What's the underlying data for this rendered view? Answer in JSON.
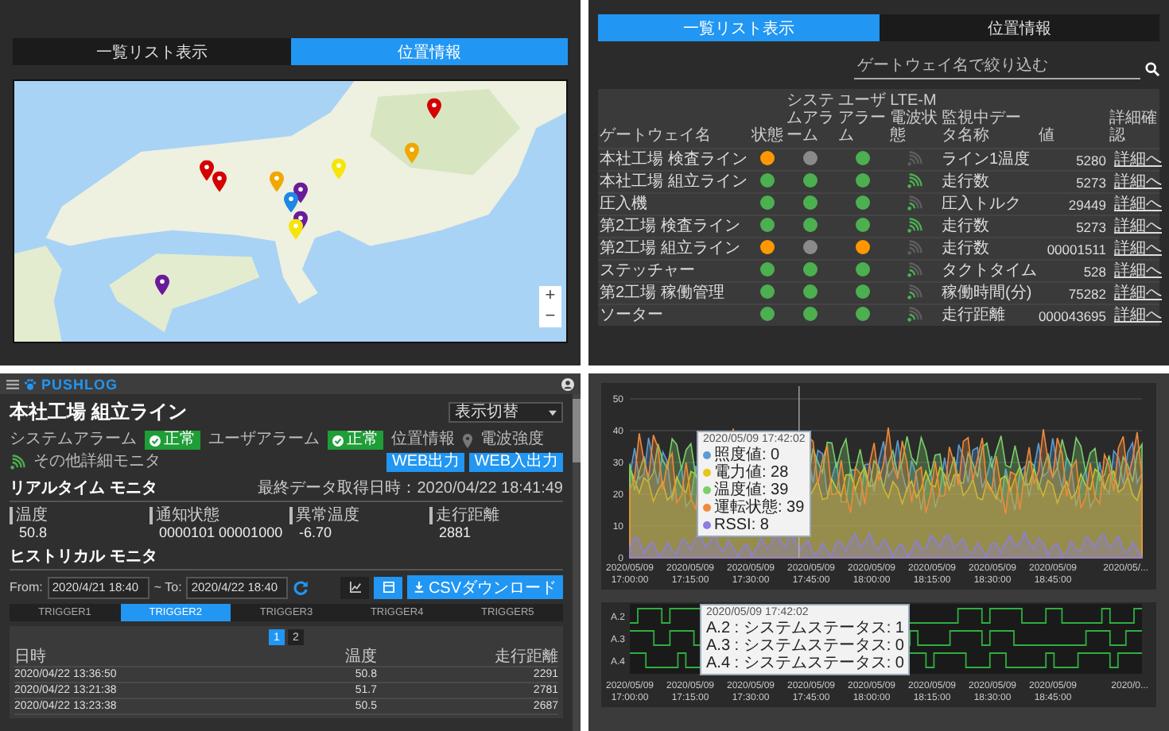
{
  "map_panel": {
    "tabs": [
      {
        "label": "一覧リスト表示",
        "selected": false
      },
      {
        "label": "位置情報",
        "selected": true
      }
    ],
    "pins": [
      {
        "color": "#d50000"
      },
      {
        "color": "#f0a800"
      },
      {
        "color": "#f5e50a"
      },
      {
        "color": "#d50000"
      },
      {
        "color": "#d50000"
      },
      {
        "color": "#f0a800"
      },
      {
        "color": "#6a1b9a"
      },
      {
        "color": "#1e88e5"
      },
      {
        "color": "#6a1b9a"
      },
      {
        "color": "#f5e50a"
      },
      {
        "color": "#6a1b9a"
      }
    ],
    "zoom_in": "+",
    "zoom_out": "−"
  },
  "list_panel": {
    "tabs": [
      {
        "label": "一覧リスト表示",
        "selected": true
      },
      {
        "label": "位置情報",
        "selected": false
      }
    ],
    "search": {
      "placeholder": "ゲートウェイ名で絞り込む"
    },
    "table": {
      "columns": [
        "ゲートウェイ名",
        "状態",
        "システムアラーム",
        "ユーザアラーム",
        "LTE-M電波状態",
        "監視中データ名称",
        "値",
        "詳細確認"
      ],
      "rows": [
        {
          "name": "本社工場 検査ライン",
          "indicators": [
            {
              "color": "#ff9800"
            },
            {
              "color": "#8a8a8a"
            },
            {
              "color": "#4caf50"
            }
          ],
          "signal": {
            "kind": "none"
          },
          "data_name": "ライン1温度",
          "value": "5280",
          "link": "詳細へ"
        },
        {
          "name": "本社工場 組立ライン",
          "indicators": [
            {
              "color": "#4caf50"
            },
            {
              "color": "#4caf50"
            },
            {
              "color": "#4caf50"
            }
          ],
          "signal": {
            "kind": "strong"
          },
          "data_name": "走行数",
          "value": "5273",
          "link": "詳細へ"
        },
        {
          "name": "圧入機",
          "indicators": [
            {
              "color": "#4caf50"
            },
            {
              "color": "#4caf50"
            },
            {
              "color": "#4caf50"
            }
          ],
          "signal": {
            "kind": "weak"
          },
          "data_name": "圧入トルク",
          "value": "29449",
          "link": "詳細へ"
        },
        {
          "name": "第2工場 検査ライン",
          "indicators": [
            {
              "color": "#4caf50"
            },
            {
              "color": "#4caf50"
            },
            {
              "color": "#4caf50"
            }
          ],
          "signal": {
            "kind": "strong"
          },
          "data_name": "走行数",
          "value": "5273",
          "link": "詳細へ"
        },
        {
          "name": "第2工場 組立ライン",
          "indicators": [
            {
              "color": "#ff9800"
            },
            {
              "color": "#8a8a8a"
            },
            {
              "color": "#ff9800"
            }
          ],
          "signal": {
            "kind": "none"
          },
          "data_name": "走行数",
          "value": "00001511",
          "link": "詳細へ"
        },
        {
          "name": "ステッチャー",
          "indicators": [
            {
              "color": "#4caf50"
            },
            {
              "color": "#4caf50"
            },
            {
              "color": "#4caf50"
            }
          ],
          "signal": {
            "kind": "weak"
          },
          "data_name": "タクトタイム",
          "value": "528",
          "link": "詳細へ"
        },
        {
          "name": "第2工場 稼働管理",
          "indicators": [
            {
              "color": "#4caf50"
            },
            {
              "color": "#4caf50"
            },
            {
              "color": "#4caf50"
            }
          ],
          "signal": {
            "kind": "weak"
          },
          "data_name": "稼働時間(分)",
          "value": "75282",
          "link": "詳細へ"
        },
        {
          "name": "ソーター",
          "indicators": [
            {
              "color": "#4caf50"
            },
            {
              "color": "#4caf50"
            },
            {
              "color": "#4caf50"
            }
          ],
          "signal": {
            "kind": "weak"
          },
          "data_name": "走行距離",
          "value": "000043695",
          "link": "詳細へ"
        }
      ]
    }
  },
  "detail_panel": {
    "logo": "PUSHLOG",
    "title": "本社工場 組立ライン",
    "view_select": "表示切替",
    "status": [
      {
        "kind": "badge",
        "label": "システムアラーム",
        "badge": "正常"
      },
      {
        "kind": "badge",
        "label": "ユーザアラーム",
        "badge": "正常"
      },
      {
        "kind": "pin",
        "label": "位置情報"
      },
      {
        "kind": "signal",
        "label": "電波強度"
      },
      {
        "kind": "text",
        "label": "その他詳細モニタ"
      }
    ],
    "buttons": [
      "WEB出力",
      "WEB入出力"
    ],
    "realtime": {
      "title": "リアルタイム モニタ",
      "updated": "最終データ取得日時：2020/04/22 18:41:49",
      "cells": [
        {
          "label": "温度",
          "value": "50.8"
        },
        {
          "label": "通知状態",
          "value": "0000101 00001000"
        },
        {
          "label": "異常温度",
          "value": "-6.70"
        },
        {
          "label": "走行距離",
          "value": "2881"
        }
      ]
    },
    "historical": {
      "title": "ヒストリカル モニタ",
      "from_label": "From:",
      "from": "2020/4/21 18:40",
      "to_label": "~ To:",
      "to": "2020/4/22 18:40",
      "view_buttons": [
        {
          "kind": "chart",
          "selected": false
        },
        {
          "kind": "table",
          "selected": true
        }
      ],
      "download": "CSVダウンロード",
      "tabs": [
        {
          "label": "TRIGGER1",
          "selected": false
        },
        {
          "label": "TRIGGER2",
          "selected": true
        },
        {
          "label": "TRIGGER3",
          "selected": false
        },
        {
          "label": "TRIGGER4",
          "selected": false
        },
        {
          "label": "TRIGGER5",
          "selected": false
        }
      ],
      "pages": [
        {
          "label": "1",
          "selected": true
        },
        {
          "label": "2",
          "selected": false
        }
      ],
      "columns": [
        "日時",
        "温度",
        "走行距離"
      ],
      "rows": [
        [
          "2020/04/22 13:36:50",
          "50.8",
          "2291"
        ],
        [
          "2020/04/22 13:21:38",
          "51.7",
          "2781"
        ],
        [
          "2020/04/22 13:23:38",
          "50.5",
          "2687"
        ]
      ]
    }
  },
  "chart_panel": {
    "y_ticks": [
      "50",
      "40",
      "30",
      "20",
      "10",
      "0"
    ],
    "x_labels": [
      {
        "date": "2020/05/09",
        "time": "17:00:00"
      },
      {
        "date": "2020/05/09",
        "time": "17:15:00"
      },
      {
        "date": "2020/05/09",
        "time": "17:30:00"
      },
      {
        "date": "2020/05/09",
        "time": "17:45:00"
      },
      {
        "date": "2020/05/09",
        "time": "18:00:00"
      },
      {
        "date": "2020/05/09",
        "time": "18:15:00"
      },
      {
        "date": "2020/05/09",
        "time": "18:30:00"
      },
      {
        "date": "2020/05/09",
        "time": "18:45:00"
      },
      {
        "date": "2020/05/..."
      }
    ],
    "tooltip": {
      "time": "2020/05/09 17:42:02",
      "items": [
        {
          "text": "照度値: 0",
          "color": "#5b9bd5"
        },
        {
          "text": "電力値: 28",
          "color": "#e6c619"
        },
        {
          "text": "温度値: 39",
          "color": "#7ccf6b"
        },
        {
          "text": "運転状態: 39",
          "color": "#f08a3c"
        },
        {
          "text": "RSSI: 8",
          "color": "#8c7fe0"
        }
      ]
    },
    "status_chart": {
      "rows": [
        "A.2",
        "A.3",
        "A.4"
      ],
      "tooltip": {
        "time": "2020/05/09 17:42:02",
        "items": [
          "A.2 : システムステータス: 1",
          "A.3 : システムステータス: 0",
          "A.4 : システムステータス: 0"
        ]
      },
      "x_labels": [
        {
          "date": "2020/05/09",
          "time": "17:00:00"
        },
        {
          "date": "2020/05/09",
          "time": "17:15:00"
        },
        {
          "date": "2020/05/09",
          "time": "17:30:00"
        },
        {
          "date": "2020/05/09",
          "time": "17:45:00"
        },
        {
          "date": "2020/05/09",
          "time": "18:00:00"
        },
        {
          "date": "2020/05/09",
          "time": "18:15:00"
        },
        {
          "date": "2020/05/09",
          "time": "18:30:00"
        },
        {
          "date": "2020/05/09",
          "time": "18:45:00"
        },
        {
          "date": "2020/0..."
        }
      ]
    }
  }
}
